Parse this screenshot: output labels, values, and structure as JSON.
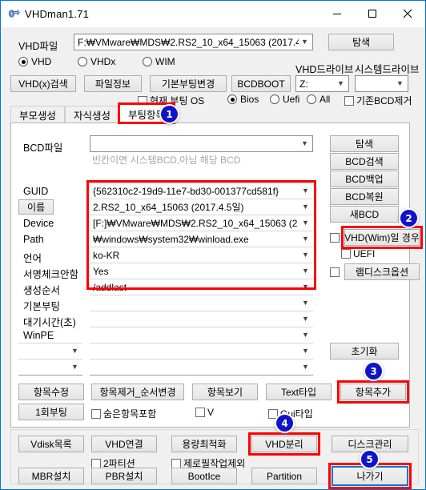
{
  "window": {
    "title": "VHDman1.71",
    "icon": "vhd-app-icon",
    "minimize": "─",
    "maximize": "□",
    "close": "✕"
  },
  "top": {
    "vhd_file_label": "VHD파일",
    "vhd_file_value": "F:₩VMware₩MDS₩2.RS2_10_x64_15063 (2017.4.",
    "browse_button": "탐색",
    "type_radios": [
      {
        "label": "VHD",
        "selected": true
      },
      {
        "label": "VHDx",
        "selected": false
      },
      {
        "label": "WIM",
        "selected": false
      }
    ],
    "vhd_drive_label": "VHD드라이브",
    "system_drive_label": "시스템드라이브",
    "vhd_drive_value": "Z:",
    "system_drive_value": "",
    "buttons": [
      "VHD(x)검색",
      "파일정보",
      "기본부팅변경",
      "BCDBOOT"
    ],
    "current_boot_os": "현재 부팅 OS",
    "firmware_radios": [
      {
        "label": "Bios",
        "selected": true
      },
      {
        "label": "Uefi",
        "selected": false
      },
      {
        "label": "All",
        "selected": false
      }
    ],
    "remove_bcd": "기존BCD제거"
  },
  "tabs": [
    {
      "label": "부모생성",
      "selected": false
    },
    {
      "label": "자식생성",
      "selected": false
    },
    {
      "label": "부팅항목",
      "selected": true
    }
  ],
  "panel": {
    "bcd_file_label": "BCD파일",
    "bcd_file_value": "",
    "bcd_hint": "빈칸이면 시스템BCD,아님 해당 BCD",
    "fields": [
      {
        "label": "GUID",
        "value": "{562310c2-19d9-11e7-bd30-001377cd581f}",
        "is_button_label": false
      },
      {
        "label": "이름",
        "value": "2.RS2_10_x64_15063 (2017.4.5일)",
        "is_button_label": true
      },
      {
        "label": "Device",
        "value": "[F:]₩VMware₩MDS₩2.RS2_10_x64_15063 (2",
        "is_button_label": false
      },
      {
        "label": "Path",
        "value": "₩windows₩system32₩winload.exe",
        "is_button_label": false
      },
      {
        "label": "언어",
        "value": "ko-KR",
        "is_button_label": false
      },
      {
        "label": "서명체크안함",
        "value": "Yes",
        "is_button_label": false
      },
      {
        "label": "생성순서",
        "value": "/addlast",
        "is_button_label": false
      },
      {
        "label": "기본부팅",
        "value": "",
        "is_button_label": false
      },
      {
        "label": "대기시간(초)",
        "value": "",
        "is_button_label": false
      },
      {
        "label": "WinPE",
        "value": "",
        "is_button_label": false
      }
    ],
    "extra_left_combos": [
      "",
      ""
    ],
    "extra_right_combos": [
      "",
      ""
    ],
    "right_buttons": [
      "탐색",
      "BCD검색",
      "BCD백업",
      "BCD복원",
      "새BCD"
    ],
    "vhd_wim_button": "VHD(Wim)일 경우",
    "uefi_checkbox": "UEFI",
    "ramdisk_button": "램디스크옵션",
    "reset_button": "초기화",
    "action_buttons": [
      "항목수정",
      "항목제거_순서변경",
      "항목보기",
      "Text타입",
      "항목추가"
    ],
    "once_boot_button": "1회부팅",
    "bottom_checks": [
      "숨은항목포함",
      "V",
      "Gui타입"
    ]
  },
  "footer": {
    "row1": [
      "Vdisk목록",
      "VHD연결",
      "용량최적화",
      "VHD분리",
      "디스크관리"
    ],
    "checks": [
      "2파티션",
      "제로필작업제외"
    ],
    "row2": [
      "MBR설치",
      "PBR설치",
      "BootIce",
      "Partition",
      "나가기"
    ]
  },
  "annotations": {
    "badges": [
      "1",
      "2",
      "3",
      "4",
      "5"
    ],
    "highlight_color": "#fe0000",
    "badge_color": "#1014c8",
    "focus_color": "#0078d7"
  }
}
